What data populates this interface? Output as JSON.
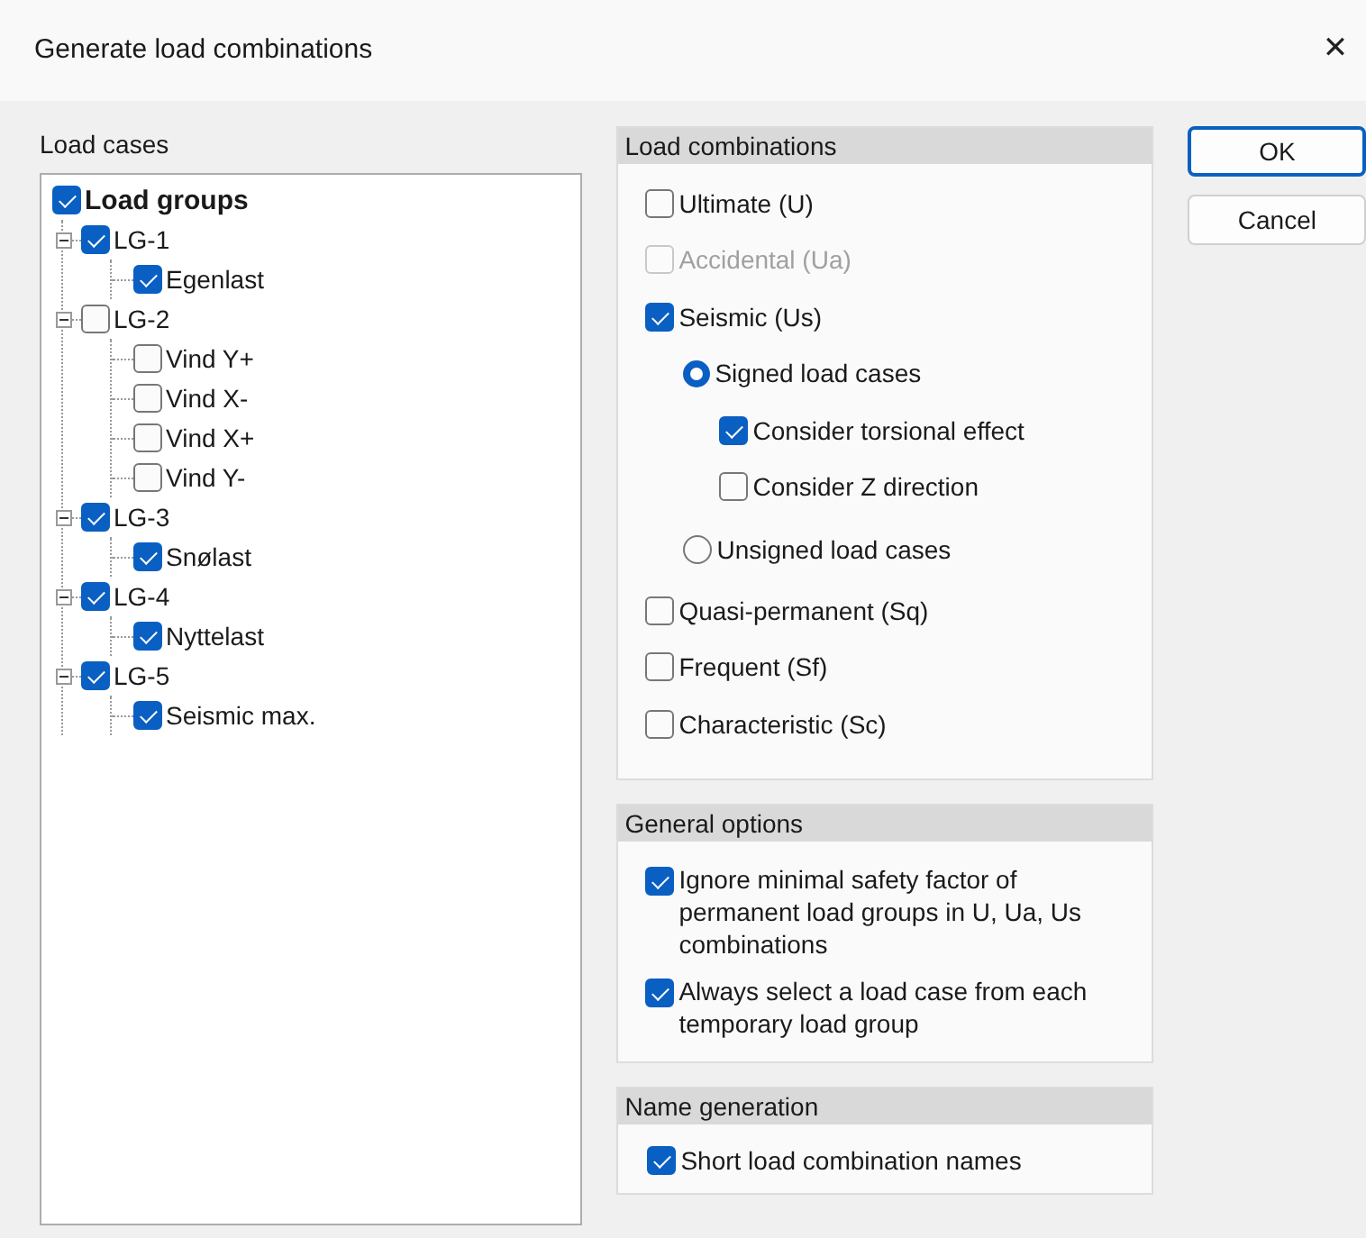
{
  "window": {
    "title": "Generate load combinations",
    "close": "✕"
  },
  "load_cases": {
    "label": "Load cases",
    "tree": {
      "label": "Load groups",
      "checked": true,
      "children": [
        {
          "label": "LG-1",
          "checked": true,
          "expanded": true,
          "children": [
            {
              "label": "Egenlast",
              "checked": true
            }
          ]
        },
        {
          "label": "LG-2",
          "checked": false,
          "expanded": true,
          "children": [
            {
              "label": "Vind Y+",
              "checked": false
            },
            {
              "label": "Vind X-",
              "checked": false
            },
            {
              "label": "Vind X+",
              "checked": false
            },
            {
              "label": "Vind Y-",
              "checked": false
            }
          ]
        },
        {
          "label": "LG-3",
          "checked": true,
          "expanded": true,
          "children": [
            {
              "label": "Snølast",
              "checked": true
            }
          ]
        },
        {
          "label": "LG-4",
          "checked": true,
          "expanded": true,
          "children": [
            {
              "label": "Nyttelast",
              "checked": true
            }
          ]
        },
        {
          "label": "LG-5",
          "checked": true,
          "expanded": true,
          "children": [
            {
              "label": "Seismic max.",
              "checked": true
            }
          ]
        }
      ]
    }
  },
  "load_combinations": {
    "title": "Load combinations",
    "items": [
      {
        "kind": "checkbox",
        "label": "Ultimate (U)",
        "checked": false,
        "disabled": false
      },
      {
        "kind": "checkbox",
        "label": "Accidental (Ua)",
        "checked": false,
        "disabled": true
      },
      {
        "kind": "checkbox",
        "label": "Seismic (Us)",
        "checked": true,
        "disabled": false,
        "children": [
          {
            "kind": "radio",
            "label": "Signed load cases",
            "selected": true,
            "children": [
              {
                "kind": "checkbox",
                "label": "Consider torsional effect",
                "checked": true,
                "disabled": false
              },
              {
                "kind": "checkbox",
                "label": "Consider Z direction",
                "checked": false,
                "disabled": false
              }
            ]
          },
          {
            "kind": "radio",
            "label": "Unsigned load cases",
            "selected": false
          }
        ]
      },
      {
        "kind": "checkbox",
        "label": "Quasi-permanent (Sq)",
        "checked": false,
        "disabled": false
      },
      {
        "kind": "checkbox",
        "label": "Frequent (Sf)",
        "checked": false,
        "disabled": false
      },
      {
        "kind": "checkbox",
        "label": "Characteristic (Sc)",
        "checked": false,
        "disabled": false
      }
    ]
  },
  "general_options": {
    "title": "General options",
    "items": [
      {
        "label": "Ignore minimal safety factor of permanent load groups in U, Ua, Us combinations",
        "checked": true
      },
      {
        "label": "Always select a load case from each temporary load group",
        "checked": true
      }
    ]
  },
  "name_generation": {
    "title": "Name generation",
    "items": [
      {
        "label": "Short load combination names",
        "checked": true
      }
    ]
  },
  "buttons": [
    {
      "label": "OK",
      "default": true
    },
    {
      "label": "Cancel",
      "default": false
    }
  ]
}
